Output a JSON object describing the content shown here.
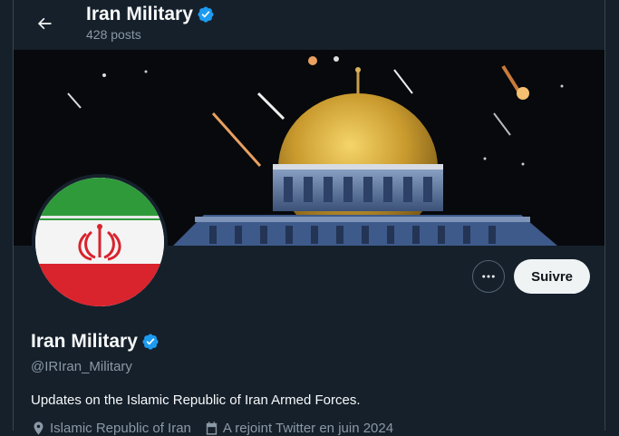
{
  "header": {
    "title": "Iran Military",
    "posts": "428 posts"
  },
  "profile": {
    "name": "Iran Military",
    "handle": "@IRIran_Military",
    "bio": "Updates on the Islamic Republic of Iran Armed Forces.",
    "location": "Islamic Republic of Iran",
    "joined": "A rejoint Twitter en juin 2024"
  },
  "actions": {
    "follow_label": "Suivre"
  },
  "colors": {
    "background": "#15202b",
    "verified": "#1d9bf0",
    "secondary_text": "#8b98a5"
  },
  "icons": [
    "back-arrow-icon",
    "verified-badge-icon",
    "more-options-icon",
    "location-icon",
    "calendar-icon"
  ]
}
